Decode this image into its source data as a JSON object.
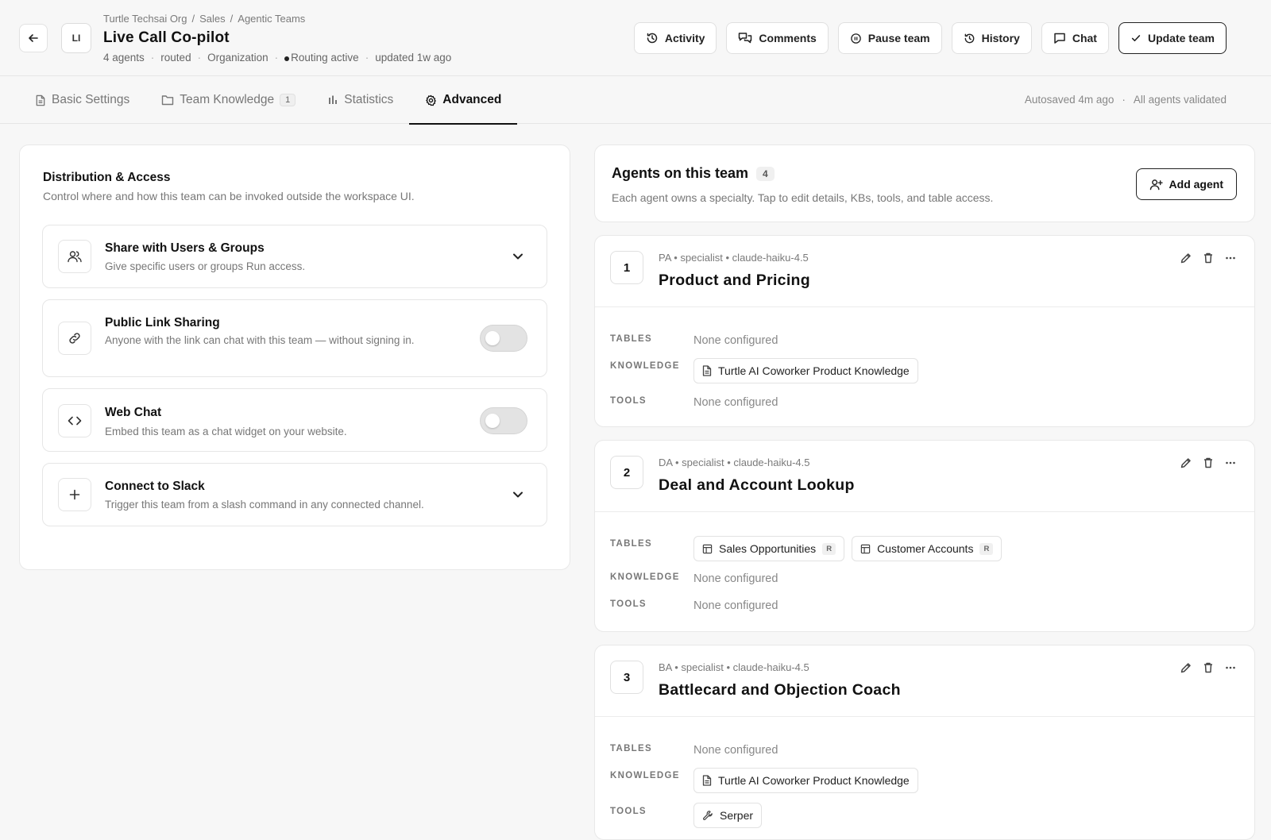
{
  "header": {
    "avatar": "LI",
    "breadcrumb": [
      "Turtle Techsai Org",
      "Sales",
      "Agentic Teams"
    ],
    "breadcrumb_sep": "/",
    "title": "Live Call Co-pilot",
    "meta": {
      "agents": "4 agents",
      "mode": "routed",
      "scope": "Organization",
      "status": "Routing active",
      "updated": "updated 1w ago",
      "sep": "·"
    },
    "actions": {
      "activity": "Activity",
      "comments": "Comments",
      "pause": "Pause team",
      "history": "History",
      "chat": "Chat",
      "update": "Update team"
    }
  },
  "tabs": [
    {
      "label": "Basic Settings"
    },
    {
      "label": "Team Knowledge",
      "count": "1"
    },
    {
      "label": "Statistics"
    },
    {
      "label": "Advanced",
      "active": true
    }
  ],
  "autosave": {
    "saved": "Autosaved 4m ago",
    "sep": "·",
    "validated": "All agents validated"
  },
  "distribution": {
    "title": "Distribution & Access",
    "subtitle": "Control where and how this team can be invoked outside the workspace UI.",
    "settings": [
      {
        "title": "Share with Users & Groups",
        "desc": "Give specific users or groups Run access.",
        "control": "expand",
        "icon": "users-icon"
      },
      {
        "title": "Public Link Sharing",
        "desc": "Anyone with the link can chat with this team — without signing in.",
        "control": "toggle",
        "enabled": false,
        "icon": "link-icon"
      },
      {
        "title": "Web Chat",
        "desc": "Embed this team as a chat widget on your website.",
        "control": "toggle",
        "enabled": false,
        "icon": "code-icon"
      },
      {
        "title": "Connect to Slack",
        "desc": "Trigger this team from a slash command in any connected channel.",
        "control": "expand",
        "icon": "plus-icon"
      }
    ]
  },
  "agents": {
    "title": "Agents on this team",
    "count": "4",
    "subtitle": "Each agent owns a specialty. Tap to edit details, KBs, tools, and table access.",
    "add_label": "Add agent",
    "labels": {
      "tables": "TABLES",
      "knowledge": "KNOWLEDGE",
      "tools": "TOOLS",
      "none": "None configured",
      "read_badge": "R"
    },
    "list": [
      {
        "num": "1",
        "meta": "PA • specialist • claude-haiku-4.5",
        "name": "Product and Pricing",
        "tables": [],
        "knowledge": [
          "Turtle AI Coworker Product Knowledge"
        ],
        "tools": []
      },
      {
        "num": "2",
        "meta": "DA • specialist • claude-haiku-4.5",
        "name": "Deal and Account Lookup",
        "tables": [
          "Sales Opportunities",
          "Customer Accounts"
        ],
        "knowledge": [],
        "tools": []
      },
      {
        "num": "3",
        "meta": "BA • specialist • claude-haiku-4.5",
        "name": "Battlecard and Objection Coach",
        "tables": [],
        "knowledge": [
          "Turtle AI Coworker Product Knowledge"
        ],
        "tools": [
          "Serper"
        ]
      }
    ]
  },
  "colors": {
    "text": "#111111",
    "muted": "#777777",
    "border": "#e6e6e6",
    "background": "#f7f7f7"
  }
}
